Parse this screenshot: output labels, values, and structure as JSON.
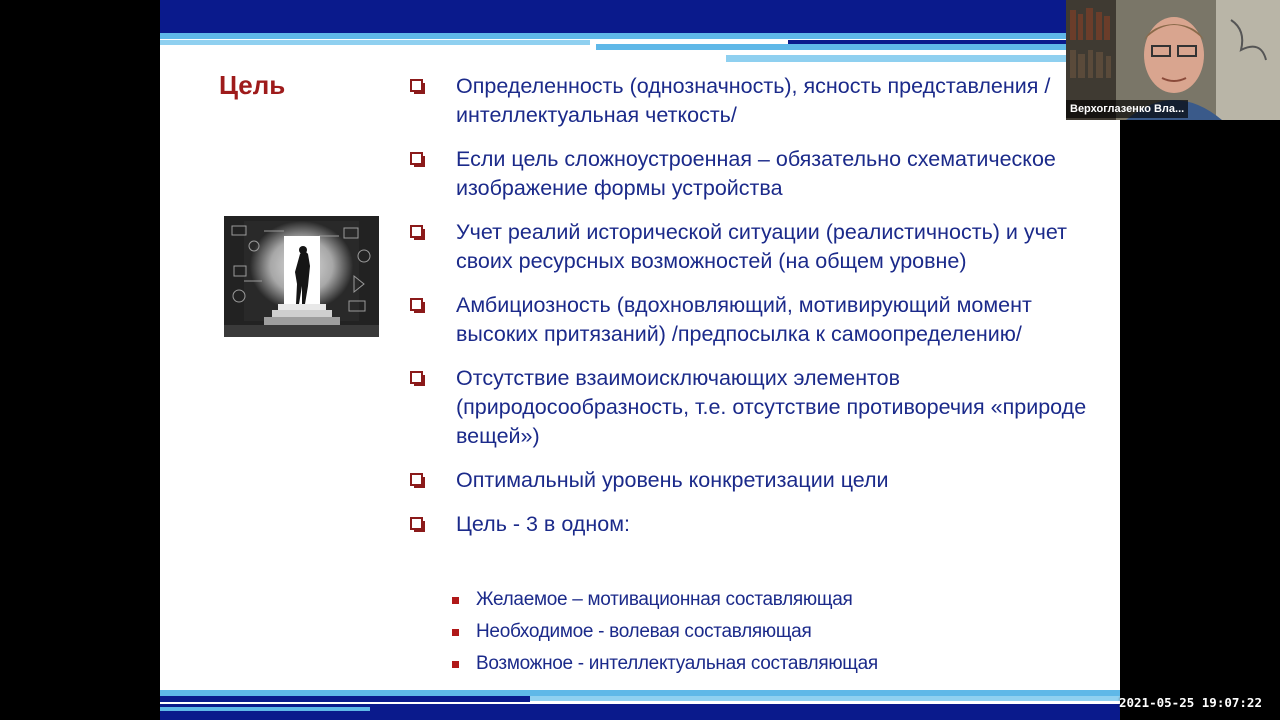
{
  "slide": {
    "title": "Цель",
    "bullets": [
      "Определенность (однозначность), ясность представления /интеллектуальная четкость/",
      "Если цель сложноустроенная – обязательно схематическое изображение формы устройства",
      "Учет реалий исторической ситуации (реалистичность) и учет своих ресурсных возможностей (на общем уровне)",
      "Амбициозность (вдохновляющий, мотивирующий момент высоких притязаний) /предпосылка к самоопределению/",
      "Отсутствие взаимоисключающих элементов (природосообразность, т.е. отсутствие противоречия «природе вещей»)",
      "Оптимальный уровень конкретизации цели",
      "Цель - 3 в одном:"
    ],
    "subbullets": [
      "Желаемое – мотивационная составляющая",
      "Необходимое - волевая составляющая",
      "Возможное - интеллектуальная составляющая"
    ]
  },
  "video": {
    "participant_name": "Верхоглазенко Вла..."
  },
  "recording": {
    "timestamp": "2021-05-25 19:07:22"
  },
  "colors": {
    "title": "#9e1b1b",
    "text": "#1b2a8a",
    "band_dark": "#0a1a8c",
    "band_light": "#5fb8e8"
  }
}
